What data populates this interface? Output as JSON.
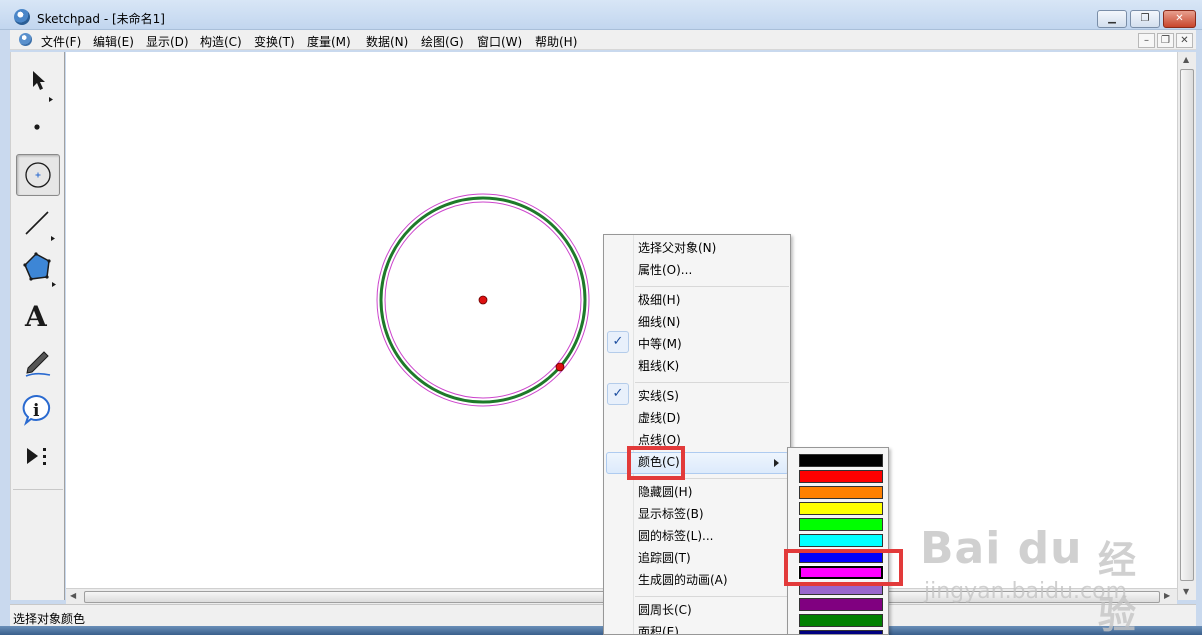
{
  "window": {
    "title": "Sketchpad  - [未命名1]"
  },
  "menubar": {
    "items": [
      "文件(F)",
      "编辑(E)",
      "显示(D)",
      "构造(C)",
      "变换(T)",
      "度量(M)",
      "数据(N)",
      "绘图(G)",
      "窗口(W)",
      "帮助(H)"
    ]
  },
  "toolbox": {
    "tools": [
      "arrow-tool",
      "point-tool",
      "compass-tool",
      "straightedge-tool",
      "polygon-tool",
      "text-tool",
      "marker-tool",
      "information-tool",
      "custom-tool"
    ],
    "active": "compass-tool"
  },
  "canvas": {
    "circle_color": "#1e7a2a",
    "selection_color": "#cc44cc",
    "point_color": "#dd1111"
  },
  "context_menu": {
    "items": [
      {
        "label": "选择父对象(N)",
        "checked": false
      },
      {
        "label": "属性(O)...",
        "checked": false
      },
      {
        "label": "极细(H)",
        "checked": false
      },
      {
        "label": "细线(N)",
        "checked": false
      },
      {
        "label": "中等(M)",
        "checked": true
      },
      {
        "label": "粗线(K)",
        "checked": false
      },
      {
        "label": "实线(S)",
        "checked": true
      },
      {
        "label": "虚线(D)",
        "checked": false
      },
      {
        "label": "点线(O)",
        "checked": false
      },
      {
        "label": "颜色(C)",
        "checked": false,
        "submenu": true,
        "highlighted": true
      },
      {
        "label": "隐藏圆(H)",
        "checked": false
      },
      {
        "label": "显示标签(B)",
        "checked": false
      },
      {
        "label": "圆的标签(L)...",
        "checked": false
      },
      {
        "label": "追踪圆(T)",
        "checked": false
      },
      {
        "label": "生成圆的动画(A)",
        "checked": false
      },
      {
        "label": "圆周长(C)",
        "checked": false
      },
      {
        "label": "面积(E)",
        "checked": false
      }
    ]
  },
  "color_palette": {
    "swatches": [
      "#000000",
      "#ff0000",
      "#ff8000",
      "#ffff00",
      "#00ff00",
      "#00ffff",
      "#0000ff",
      "#ff00ff",
      "#9966cc",
      "#800080",
      "#008000",
      "#000080"
    ],
    "selected": "#ff00ff"
  },
  "statusbar": {
    "text": "选择对象颜色"
  },
  "watermark": {
    "logo": "Bai du",
    "cn": "经验",
    "url": "jingyan.baidu.com"
  }
}
